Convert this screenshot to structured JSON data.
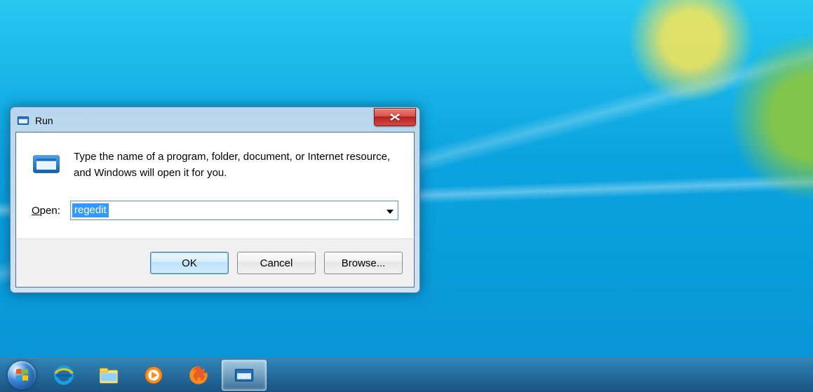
{
  "window": {
    "title": "Run",
    "description": "Type the name of a program, folder, document, or Internet resource, and Windows will open it for you.",
    "open_label_prefix": "O",
    "open_label_rest": "pen:",
    "input_value": "regedit",
    "buttons": {
      "ok": "OK",
      "cancel": "Cancel",
      "browse": "Browse..."
    }
  },
  "taskbar": {
    "items": [
      {
        "name": "internet-explorer"
      },
      {
        "name": "file-explorer"
      },
      {
        "name": "windows-media-player"
      },
      {
        "name": "firefox"
      },
      {
        "name": "run",
        "active": true
      }
    ]
  }
}
